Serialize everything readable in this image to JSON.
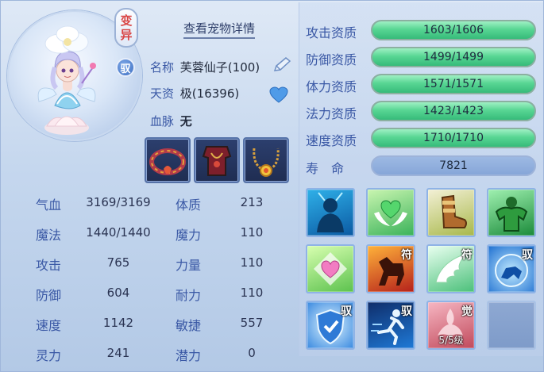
{
  "transform_button": {
    "line1": "变",
    "line2": "异"
  },
  "ride_badge": "驭",
  "detail_link": "查看宠物详情",
  "info": {
    "name_label": "名称",
    "name_value": "芙蓉仙子(100)",
    "aptitude_label": "天资",
    "aptitude_value": "极(16396)",
    "bloodline_label": "血脉",
    "bloodline_value": "无"
  },
  "attributes": [
    {
      "label": "气血",
      "value": "3169/3169"
    },
    {
      "label": "魔法",
      "value": "1440/1440"
    },
    {
      "label": "攻击",
      "value": "765"
    },
    {
      "label": "防御",
      "value": "604"
    },
    {
      "label": "速度",
      "value": "1142"
    },
    {
      "label": "灵力",
      "value": "241"
    }
  ],
  "points": [
    {
      "label": "体质",
      "value": "213"
    },
    {
      "label": "魔力",
      "value": "110"
    },
    {
      "label": "力量",
      "value": "110"
    },
    {
      "label": "耐力",
      "value": "110"
    },
    {
      "label": "敏捷",
      "value": "557"
    },
    {
      "label": "潜力",
      "value": "0"
    }
  ],
  "aptitudes": [
    {
      "label": "攻击资质",
      "text": "1603/1606",
      "fill": 0.998
    },
    {
      "label": "防御资质",
      "text": "1499/1499",
      "fill": 1.0
    },
    {
      "label": "体力资质",
      "text": "1571/1571",
      "fill": 1.0
    },
    {
      "label": "法力资质",
      "text": "1423/1423",
      "fill": 1.0
    },
    {
      "label": "速度资质",
      "text": "1710/1710",
      "fill": 1.0
    }
  ],
  "lifespan": {
    "label": "寿　命",
    "value": "7821"
  },
  "skills": [
    {
      "name": "skill-silhouette",
      "tag": "",
      "level": ""
    },
    {
      "name": "skill-winged-heart",
      "tag": "",
      "level": ""
    },
    {
      "name": "skill-boot",
      "tag": "",
      "level": ""
    },
    {
      "name": "skill-muscle-man",
      "tag": "",
      "level": ""
    },
    {
      "name": "skill-pink-heart",
      "tag": "",
      "level": ""
    },
    {
      "name": "skill-rune-horse",
      "tag": "符",
      "level": ""
    },
    {
      "name": "skill-rune-wing",
      "tag": "符",
      "level": ""
    },
    {
      "name": "skill-ride-beast",
      "tag": "驭",
      "level": ""
    },
    {
      "name": "skill-ride-shield",
      "tag": "驭",
      "level": ""
    },
    {
      "name": "skill-ride-runner",
      "tag": "驭",
      "level": ""
    },
    {
      "name": "skill-awaken-phoenix",
      "tag": "觉",
      "level": "5/5级"
    },
    {
      "name": "skill-empty-slot",
      "tag": "",
      "level": ""
    }
  ]
}
